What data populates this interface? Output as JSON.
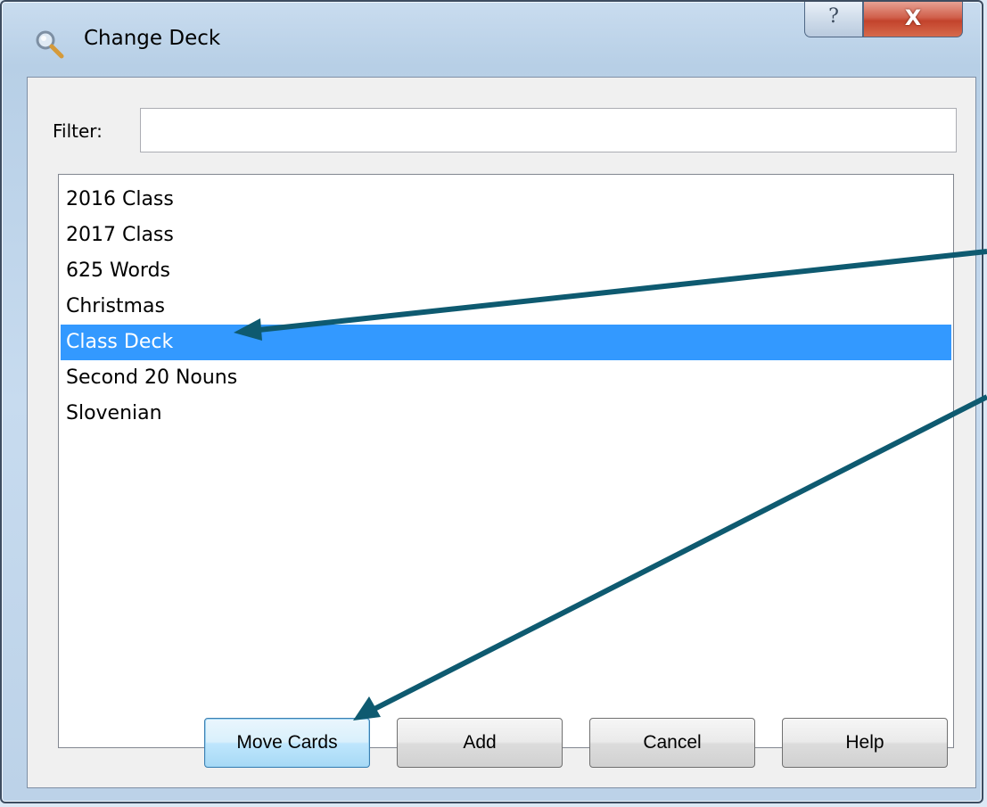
{
  "window": {
    "title": "Change Deck",
    "title_icon": "magnifier-icon",
    "help_glyph": "?",
    "close_glyph": "X"
  },
  "filter": {
    "label": "Filter:",
    "value": "",
    "placeholder": ""
  },
  "decks": [
    {
      "label": "2016 Class",
      "selected": false
    },
    {
      "label": "2017 Class",
      "selected": false
    },
    {
      "label": "625 Words",
      "selected": false
    },
    {
      "label": "Christmas",
      "selected": false
    },
    {
      "label": "Class Deck",
      "selected": true
    },
    {
      "label": "Second 20 Nouns",
      "selected": false
    },
    {
      "label": "Slovenian",
      "selected": false
    }
  ],
  "buttons": {
    "move_cards": "Move Cards",
    "add": "Add",
    "cancel": "Cancel",
    "help": "Help"
  },
  "colors": {
    "selection": "#3399ff",
    "annotation_arrow": "#0e5a70"
  }
}
